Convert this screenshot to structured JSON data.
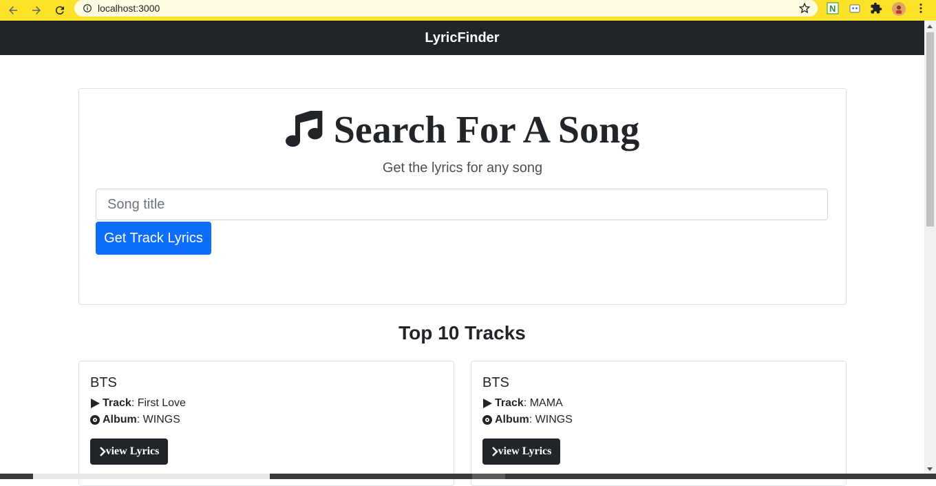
{
  "browser": {
    "url": "localhost:3000"
  },
  "navbar": {
    "brand": "LyricFinder"
  },
  "search": {
    "title": "Search For A Song",
    "subtitle": "Get the lyrics for any song",
    "placeholder": "Song title",
    "value": "",
    "button_label": "Get Track Lyrics"
  },
  "tracks_section": {
    "title": "Top 10 Tracks",
    "track_label": "Track",
    "album_label": "Album",
    "button_label": "view Lyrics",
    "items": [
      {
        "artist": "BTS",
        "track": "First Love",
        "album": "WINGS"
      },
      {
        "artist": "BTS",
        "track": "MAMA",
        "album": "WINGS"
      }
    ]
  },
  "colors": {
    "browser_bar": "#fde22a",
    "navbar": "#212529",
    "primary": "#0d6efd",
    "dark_button": "#212529"
  },
  "icons": [
    "back-arrow-icon",
    "forward-arrow-icon",
    "reload-icon",
    "info-icon",
    "star-icon",
    "extension-icon",
    "music-note-icon",
    "play-icon",
    "album-disc-icon",
    "chevron-right-icon",
    "menu-dots-icon"
  ]
}
